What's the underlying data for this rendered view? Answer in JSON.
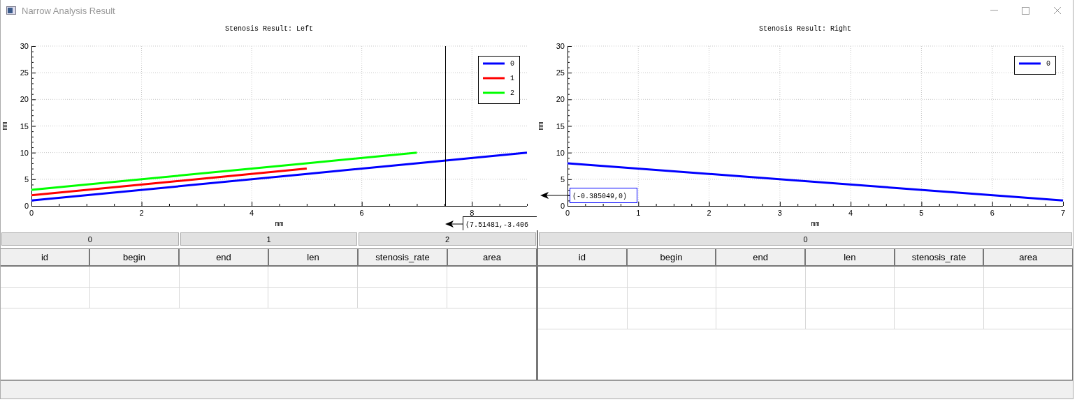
{
  "window": {
    "title": "Narrow Analysis Result"
  },
  "charts": [
    {
      "chart_data": {
        "type": "line",
        "title": "Stenosis Result: Left",
        "xlabel": "mm",
        "ylabel": "mm",
        "x": [
          0,
          5,
          7,
          9
        ],
        "xlim": [
          0,
          9
        ],
        "ylim": [
          0,
          30
        ],
        "xticks": [
          0,
          2,
          4,
          6,
          8
        ],
        "yticks": [
          0,
          5,
          10,
          15,
          20,
          25,
          30
        ],
        "series": [
          {
            "name": "0",
            "color": "#0000ff",
            "values": [
              1,
              6,
              8,
              10
            ]
          },
          {
            "name": "1",
            "color": "#ff0000",
            "values": [
              2,
              7,
              null,
              null
            ]
          },
          {
            "name": "2",
            "color": "#00ff00",
            "values": [
              3,
              8,
              10,
              null
            ]
          }
        ],
        "grid": true,
        "legend": true,
        "ref_lines": [
          {
            "axis": "x",
            "value": 7.51481
          }
        ]
      },
      "tracer": {
        "kind": "below",
        "label": "(7.51481,-3.406"
      }
    },
    {
      "chart_data": {
        "type": "line",
        "title": "Stenosis Result: Right",
        "xlabel": "mm",
        "ylabel": "mm",
        "x": [
          0,
          7
        ],
        "xlim": [
          0,
          7
        ],
        "ylim": [
          0,
          30
        ],
        "xticks": [
          0,
          1,
          2,
          3,
          4,
          5,
          6,
          7
        ],
        "yticks": [
          0,
          5,
          10,
          15,
          20,
          25,
          30
        ],
        "series": [
          {
            "name": "0",
            "color": "#0000ff",
            "values": [
              8,
              1
            ]
          }
        ],
        "grid": true,
        "legend": true
      },
      "tracer": {
        "kind": "axis",
        "label": "(-0.385049,0)"
      }
    }
  ],
  "tables": [
    {
      "groups": [
        {
          "label": "0"
        },
        {
          "label": "1"
        },
        {
          "label": "2"
        }
      ],
      "columns": [
        "id",
        "begin",
        "end",
        "len",
        "stenosis_rate",
        "area"
      ],
      "rows": [
        {
          "selected": false
        },
        {
          "selected": false
        }
      ]
    },
    {
      "groups": [
        {
          "label": "0"
        }
      ],
      "columns": [
        "id",
        "begin",
        "end",
        "len",
        "stenosis_rate",
        "area"
      ],
      "rows": [
        {
          "selected": false
        },
        {
          "selected": false
        },
        {
          "selected": false
        }
      ]
    }
  ]
}
